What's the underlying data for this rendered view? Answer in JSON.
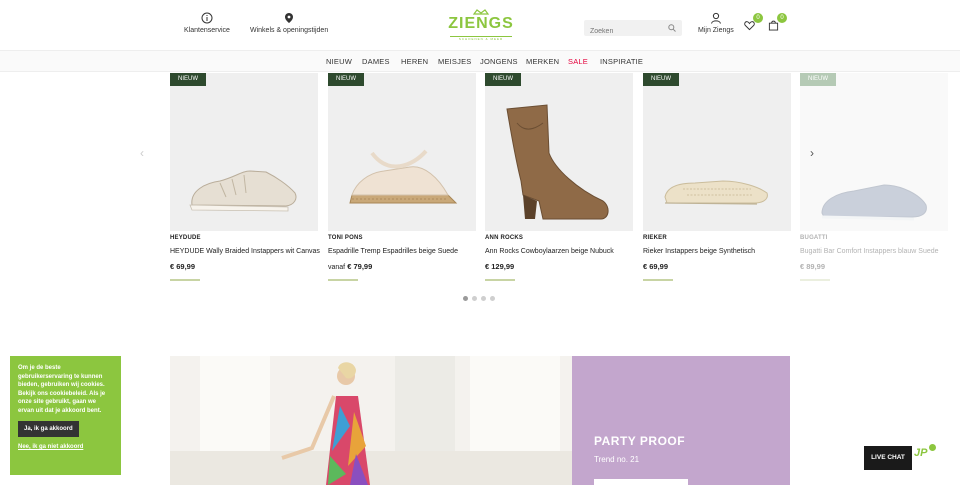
{
  "header": {
    "customer_service": "Klantenservice",
    "stores": "Winkels & openingstijden",
    "logo_text": "ZIENGS",
    "logo_tagline": "SCHOENEN & MEER",
    "search_placeholder": "Zoeken",
    "account": "Mijn Ziengs",
    "wishlist_count": "0",
    "cart_count": "0"
  },
  "nav": {
    "items": [
      "NIEUW",
      "DAMES",
      "HEREN",
      "MEISJES",
      "JONGENS",
      "MERKEN",
      "SALE",
      "INSPIRATIE"
    ]
  },
  "products": [
    {
      "tag": "NIEUW",
      "brand": "HEYDUDE",
      "name": "HEYDUDE Wally Braided Instappers wit Canvas",
      "price_prefix": "",
      "price": "€ 69,99"
    },
    {
      "tag": "NIEUW",
      "brand": "TONI PONS",
      "name": "Espadrille Tremp Espadrilles beige Suede",
      "price_prefix": "vanaf",
      "price": "€ 79,99"
    },
    {
      "tag": "NIEUW",
      "brand": "ANN ROCKS",
      "name": "Ann Rocks Cowboylaarzen beige Nubuck",
      "price_prefix": "",
      "price": "€ 129,99"
    },
    {
      "tag": "NIEUW",
      "brand": "RIEKER",
      "name": "Rieker Instappers beige Synthetisch",
      "price_prefix": "",
      "price": "€ 69,99"
    },
    {
      "tag": "NIEUW",
      "brand": "BUGATTI",
      "name": "Bugatti Bar Comfort Instappers blauw Suede",
      "price_prefix": "",
      "price": "€ 89,99"
    }
  ],
  "carousel": {
    "page_count": 4,
    "active_page": 1
  },
  "banner": {
    "title": "PARTY PROOF",
    "subtitle": "Trend no. 21"
  },
  "cookie": {
    "text": "Om je de beste gebruikerservaring te kunnen bieden, gebruiken wij cookies. Bekijk ons cookiebeleid. Als je onze site gebruikt, gaan we ervan uit dat je akkoord bent.",
    "accept": "Ja, ik ga akkoord",
    "decline": "Nee, ik ga niet akkoord"
  },
  "chat": {
    "label": "LIVE CHAT",
    "logo_text": "JP"
  },
  "colors": {
    "brand_green": "#8cc63f",
    "tag_green": "#2e4a2e",
    "sale_red": "#e4003b",
    "promo_purple": "#c3a6cd"
  }
}
